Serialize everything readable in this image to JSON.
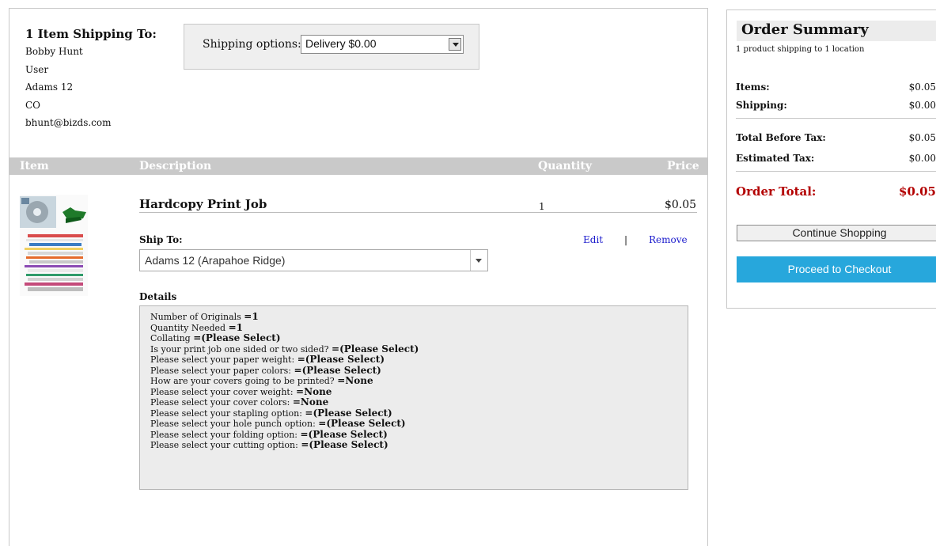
{
  "shipping_to": {
    "heading": "1 Item Shipping To:",
    "address_lines": [
      "Bobby Hunt",
      "User",
      "Adams 12",
      "CO",
      "bhunt@bizds.com"
    ]
  },
  "shipping_options": {
    "label": "Shipping options:",
    "selected": "Delivery $0.00"
  },
  "table_header": {
    "item": "Item",
    "description": "Description",
    "quantity": "Quantity",
    "price": "Price"
  },
  "item": {
    "name": "Hardcopy Print Job",
    "quantity": "1",
    "price": "$0.05",
    "ship_to_label": "Ship To:",
    "edit_label": "Edit",
    "separator": "|",
    "remove_label": "Remove",
    "ship_to_selected": "Adams 12 (Arapahoe Ridge)",
    "details_label": "Details",
    "details": [
      {
        "q": "Number of Originals",
        "a": "=1"
      },
      {
        "q": "Quantity Needed",
        "a": "=1"
      },
      {
        "q": "Collating",
        "a": "=(Please Select)"
      },
      {
        "q": "Is your print job one sided or two sided?",
        "a": "=(Please Select)"
      },
      {
        "q": "Please select your paper weight:",
        "a": "=(Please Select)"
      },
      {
        "q": "Please select your paper colors:",
        "a": "=(Please Select)"
      },
      {
        "q": "How are your covers going to be printed?",
        "a": "=None"
      },
      {
        "q": "Please select your cover weight:",
        "a": "=None"
      },
      {
        "q": "Please select your cover colors:",
        "a": "=None"
      },
      {
        "q": "Please select your stapling option:",
        "a": "=(Please Select)"
      },
      {
        "q": "Please select your hole punch option:",
        "a": "=(Please Select)"
      },
      {
        "q": "Please select your folding option:",
        "a": "=(Please Select)"
      },
      {
        "q": "Please select your cutting option:",
        "a": "=(Please Select)"
      }
    ]
  },
  "summary": {
    "title": "Order Summary",
    "subtitle": "1 product shipping to 1 location",
    "items_label": "Items:",
    "items_value": "$0.05",
    "shipping_label": "Shipping:",
    "shipping_value": "$0.00",
    "total_before_tax_label": "Total Before Tax:",
    "total_before_tax_value": "$0.05",
    "estimated_tax_label": "Estimated Tax:",
    "estimated_tax_value": "$0.00",
    "order_total_label": "Order Total:",
    "order_total_value": "$0.05",
    "continue_label": "Continue Shopping",
    "checkout_label": "Proceed to Checkout"
  },
  "colors": {
    "header_bar": "#c9c9c9",
    "total_red": "#b30000",
    "checkout_blue": "#27a7dc",
    "link_blue": "#1a1acc"
  }
}
